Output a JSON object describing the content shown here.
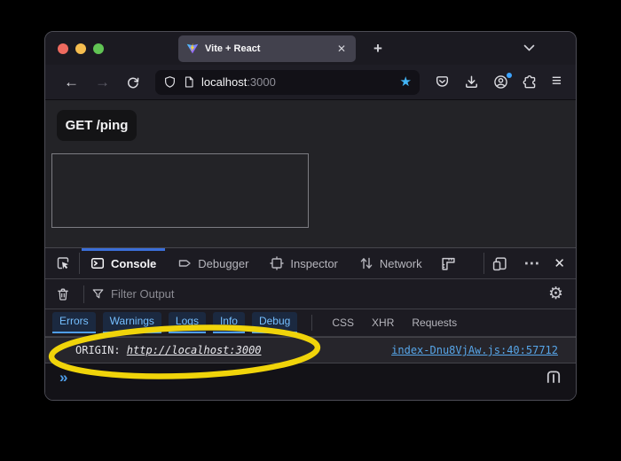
{
  "tab_bar": {
    "tab": {
      "title": "Vite + React"
    }
  },
  "nav_bar": {
    "url": {
      "host": "localhost",
      "port": ":3000"
    }
  },
  "page": {
    "ping_button": "GET /ping"
  },
  "devtools": {
    "toolbar": {
      "tabs": [
        {
          "label": "Console",
          "active": true
        },
        {
          "label": "Debugger",
          "active": false
        },
        {
          "label": "Inspector",
          "active": false
        },
        {
          "label": "Network",
          "active": false
        }
      ]
    },
    "filter_bar": {
      "placeholder": "Filter Output"
    },
    "level_filters": [
      "Errors",
      "Warnings",
      "Logs",
      "Info",
      "Debug"
    ],
    "type_filters": [
      "CSS",
      "XHR",
      "Requests"
    ],
    "console": {
      "message_prefix": "ORIGIN: ",
      "message_link": "http://localhost:3000",
      "source_link": "index-Dnu8VjAw.js:40:57712"
    }
  },
  "icons": {
    "close": "✕",
    "plus": "+",
    "back": "←",
    "forward": "→",
    "hamburger": "≡",
    "star": "★",
    "gear": "⚙",
    "more": "⋯",
    "prompt": "»"
  },
  "annotation": {
    "color": "#f0d40a"
  },
  "colors": {
    "accent_blue": "#3b6fd9",
    "link_blue": "#57a6e9",
    "filter_blue": "#75bfff",
    "star_cyan": "#42b4f5",
    "highlight_yellow": "#f0d40a"
  }
}
